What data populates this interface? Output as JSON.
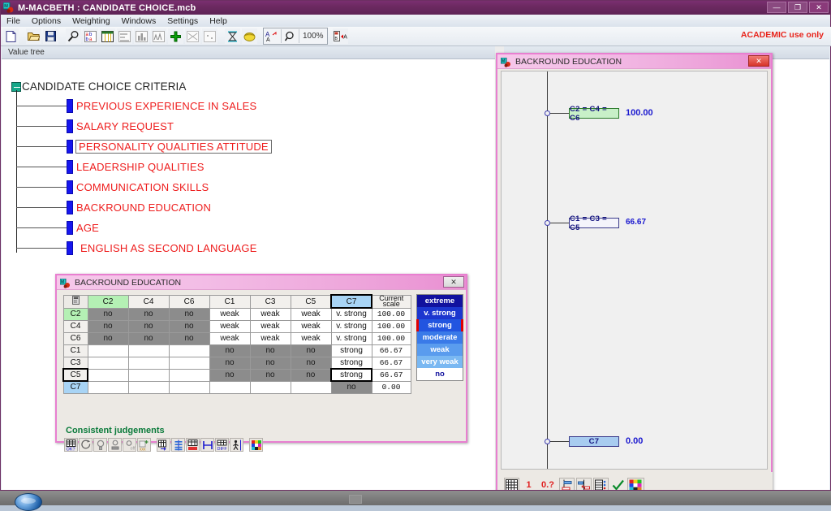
{
  "app": {
    "title": "M-MACBETH : CANDIDATE CHOICE.mcb",
    "icon": "macbeth-app-icon",
    "license_notice": "ACADEMIC use only",
    "window_buttons": [
      {
        "name": "minimize-button",
        "glyph": "—"
      },
      {
        "name": "maximize-button",
        "glyph": "❐"
      },
      {
        "name": "close-button",
        "glyph": "✕"
      }
    ]
  },
  "menu": {
    "items": [
      {
        "label": "File",
        "name": "menu-file"
      },
      {
        "label": "Options",
        "name": "menu-options"
      },
      {
        "label": "Weighting",
        "name": "menu-weighting"
      },
      {
        "label": "Windows",
        "name": "menu-windows"
      },
      {
        "label": "Settings",
        "name": "menu-settings"
      },
      {
        "label": "Help",
        "name": "menu-help"
      }
    ]
  },
  "toolbar": {
    "zoom_level": "100%",
    "buttons": [
      {
        "name": "new-file-icon"
      },
      {
        "name": "open-folder-icon"
      },
      {
        "name": "save-disk-icon"
      },
      {
        "name": "magnifier-icon"
      },
      {
        "name": "abc-letters-icon"
      },
      {
        "name": "table-grid-icon"
      },
      {
        "name": "bar-list-icon"
      },
      {
        "name": "histogram-icon"
      },
      {
        "name": "multi-bars-icon"
      },
      {
        "name": "green-plus-icon"
      },
      {
        "name": "scatter-cross-icon"
      },
      {
        "name": "dots-icon"
      },
      {
        "name": "hourglass-icon"
      },
      {
        "name": "yellow-lemon-icon"
      },
      {
        "name": "font-size-icon"
      },
      {
        "name": "zoom-glass-icon"
      },
      {
        "name": "label-arrows-icon"
      }
    ]
  },
  "value_tree": {
    "panel_title": "Value tree",
    "root": {
      "label": "CANDIDATE CHOICE CRITERIA",
      "name": "value-tree-root"
    },
    "nodes": [
      {
        "label": "PREVIOUS EXPERIENCE IN SALES",
        "selected": false
      },
      {
        "label": "SALARY REQUEST",
        "selected": false
      },
      {
        "label": "PERSONALITY QUALITIES ATTITUDE",
        "selected": true
      },
      {
        "label": "LEADERSHIP QUALITIES",
        "selected": false
      },
      {
        "label": "COMMUNICATION SKILLS",
        "selected": false
      },
      {
        "label": "BACKROUND EDUCATION",
        "selected": false
      },
      {
        "label": "AGE",
        "selected": false
      },
      {
        "label": "ENGLISH AS SECOND LANGUAGE",
        "selected": false
      }
    ]
  },
  "matrix_window": {
    "title": "BACKROUND EDUCATION",
    "icon": "macbeth-window-icon",
    "close_glyph": "✕",
    "corner_icon": "calculator-icon",
    "column_headers": [
      "C2",
      "C4",
      "C6",
      "C1",
      "C3",
      "C5",
      "C7"
    ],
    "current_scale_header_line1": "Current",
    "current_scale_header_line2": "scale",
    "rows": [
      {
        "label": "C2",
        "cells": [
          "no",
          "no",
          "no",
          "weak",
          "weak",
          "weak",
          "v. strong"
        ],
        "current_scale": "100.00"
      },
      {
        "label": "C4",
        "cells": [
          "no",
          "no",
          "no",
          "weak",
          "weak",
          "weak",
          "v. strong"
        ],
        "current_scale": "100.00"
      },
      {
        "label": "C6",
        "cells": [
          "no",
          "no",
          "no",
          "weak",
          "weak",
          "weak",
          "v. strong"
        ],
        "current_scale": "100.00"
      },
      {
        "label": "C1",
        "cells": [
          "",
          "",
          "",
          "no",
          "no",
          "no",
          "strong"
        ],
        "current_scale": "66.67"
      },
      {
        "label": "C3",
        "cells": [
          "",
          "",
          "",
          "no",
          "no",
          "no",
          "strong"
        ],
        "current_scale": "66.67"
      },
      {
        "label": "C5",
        "cells": [
          "",
          "",
          "",
          "no",
          "no",
          "no",
          "strong"
        ],
        "current_scale": "66.67"
      },
      {
        "label": "C7",
        "cells": [
          "",
          "",
          "",
          "",
          "",
          "",
          "no"
        ],
        "current_scale": "0.00"
      }
    ],
    "scale_legend": [
      {
        "label": "extreme",
        "color": "#11119e"
      },
      {
        "label": "v. strong",
        "color": "#1c36cf"
      },
      {
        "label": "strong",
        "color": "#2255e0"
      },
      {
        "label": "moderate",
        "color": "#3a7ae8"
      },
      {
        "label": "weak",
        "color": "#5a9cee"
      },
      {
        "label": "very weak",
        "color": "#7ab8f2"
      },
      {
        "label": "no",
        "color": "#ffffff"
      }
    ],
    "selected_scale_label": "strong",
    "status_text": "Consistent judgements",
    "tools": [
      {
        "name": "check-matrix-icon"
      },
      {
        "name": "refresh-circle-icon"
      },
      {
        "name": "bulb-icon"
      },
      {
        "name": "bulb-down-icon"
      },
      {
        "name": "bulb-off-icon"
      },
      {
        "name": "add-rows-icon"
      },
      {
        "name": "grid-export-icon"
      },
      {
        "name": "scale-bars-icon"
      },
      {
        "name": "histogram-red-icon"
      },
      {
        "name": "interval-icon"
      },
      {
        "name": "diff-icon"
      },
      {
        "name": "figure-icon"
      },
      {
        "name": "color-palette-icon"
      }
    ]
  },
  "thermometer_window": {
    "title": "BACKROUND EDUCATION",
    "icon": "macbeth-window-icon",
    "close_glyph": "✕",
    "points": [
      {
        "label": "C2 = C4 = C6",
        "value": "100.00",
        "style": "green"
      },
      {
        "label": "C1 = C3 = C5",
        "value": "66.67",
        "style": "white"
      },
      {
        "label": "C7",
        "value": "0.00",
        "style": "blue"
      }
    ],
    "tools": [
      {
        "name": "grid-icon"
      },
      {
        "name": "one-digit-icon",
        "label": "1"
      },
      {
        "name": "decimal-digit-icon",
        "label": "0.?"
      },
      {
        "name": "scale-anchor-icon"
      },
      {
        "name": "scale-split-icon"
      },
      {
        "name": "scale-config-icon"
      },
      {
        "name": "confirm-check-icon"
      },
      {
        "name": "color-palette-icon"
      }
    ]
  },
  "chart_data": {
    "type": "bar",
    "title": "BACKROUND EDUCATION",
    "categories": [
      "C2 = C4 = C6",
      "C1 = C3 = C5",
      "C7"
    ],
    "values": [
      100.0,
      66.67,
      0.0
    ],
    "xlabel": "",
    "ylabel": "",
    "ylim": [
      0,
      100
    ]
  }
}
